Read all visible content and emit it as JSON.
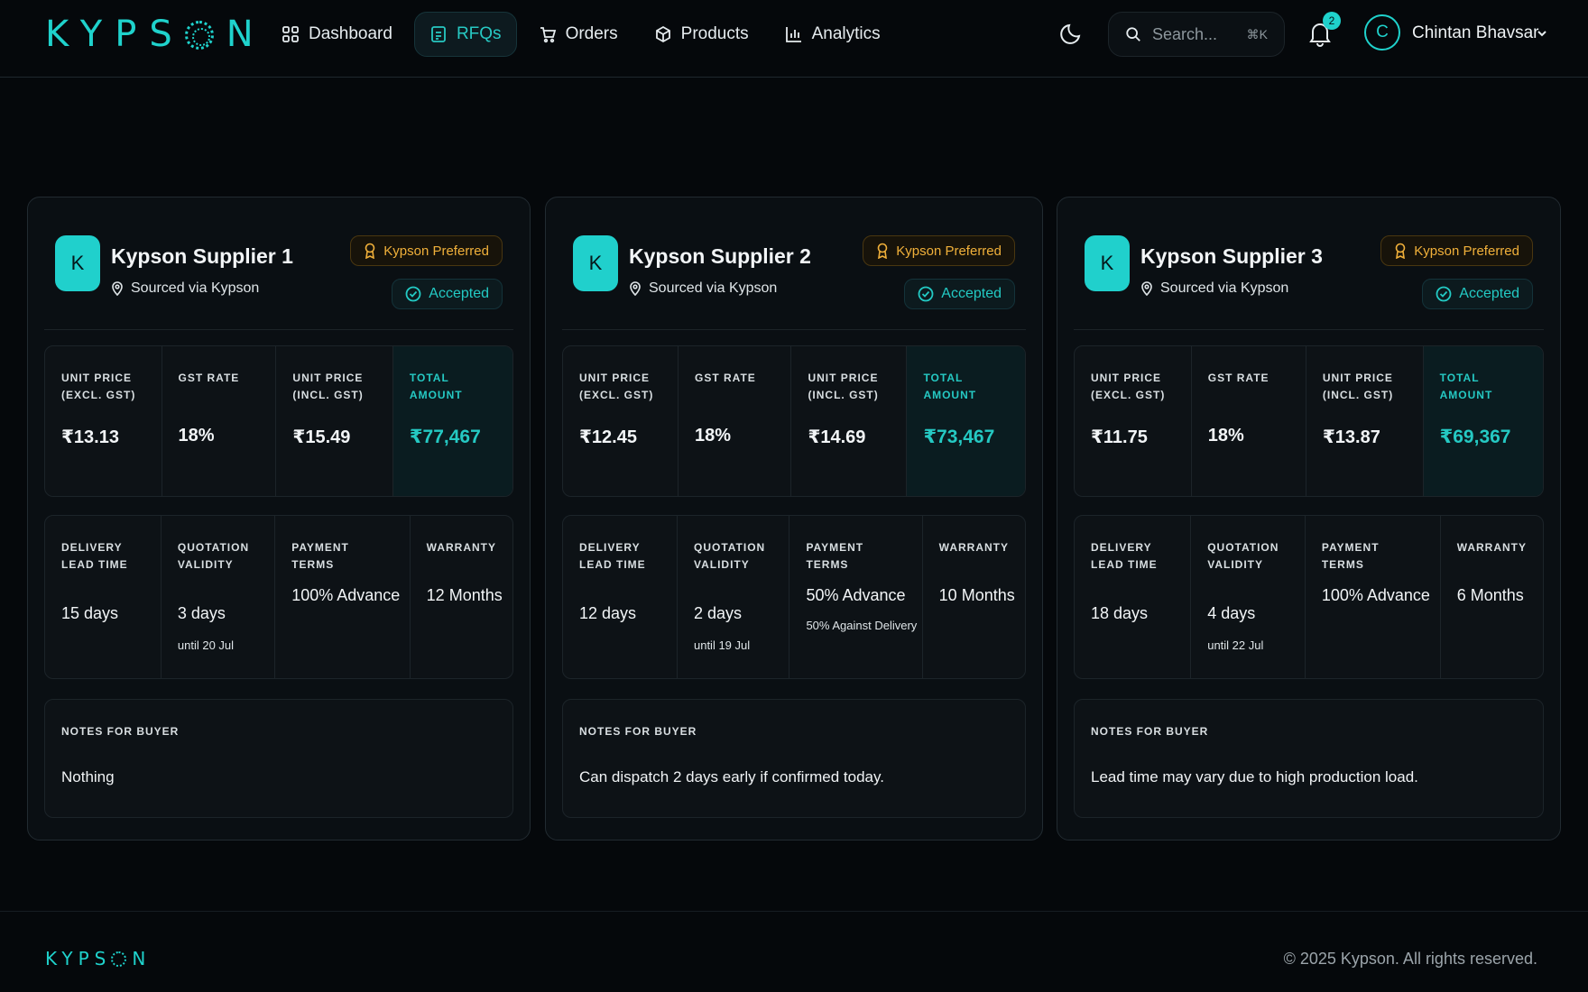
{
  "brand": {
    "logo_left": "KYPS",
    "logo_right": "N",
    "accent_color": "#1fd2cc"
  },
  "nav": {
    "items": [
      {
        "label": "Dashboard",
        "icon": "grid-icon",
        "active": false
      },
      {
        "label": "RFQs",
        "icon": "document-icon",
        "active": true
      },
      {
        "label": "Orders",
        "icon": "cart-icon",
        "active": false
      },
      {
        "label": "Products",
        "icon": "box-icon",
        "active": false
      },
      {
        "label": "Analytics",
        "icon": "bar-chart-icon",
        "active": false
      }
    ]
  },
  "header": {
    "search_placeholder": "Search...",
    "search_shortcut": "⌘K",
    "notification_count": "2",
    "user_initial": "C",
    "user_name": "Chintan Bhavsar"
  },
  "labels": {
    "unit_price_excl": "UNIT PRICE (EXCL. GST)",
    "gst_rate": "GST RATE",
    "unit_price_incl": "UNIT PRICE (INCL. GST)",
    "total_amount": "TOTAL AMOUNT",
    "delivery_lead_time": "DELIVERY LEAD TIME",
    "quotation_validity": "QUOTATION VALIDITY",
    "payment_terms": "PAYMENT TERMS",
    "warranty": "WARRANTY",
    "notes_for_buyer": "NOTES FOR BUYER"
  },
  "suppliers": [
    {
      "initial": "K",
      "name": "Kypson Supplier 1",
      "source": "Sourced via Kypson",
      "preferred_label": "Kypson Preferred",
      "status": "Accepted",
      "unit_price_excl": "₹13.13",
      "gst_rate": "18%",
      "unit_price_incl": "₹15.49",
      "total_amount": "₹77,467",
      "delivery_lead_time": "15 days",
      "quotation_validity": "3 days",
      "validity_until": "until 20 Jul",
      "payment_terms": "100% Advance",
      "payment_terms_sub": "",
      "warranty": "12 Months",
      "notes": "Nothing"
    },
    {
      "initial": "K",
      "name": "Kypson Supplier 2",
      "source": "Sourced via Kypson",
      "preferred_label": "Kypson Preferred",
      "status": "Accepted",
      "unit_price_excl": "₹12.45",
      "gst_rate": "18%",
      "unit_price_incl": "₹14.69",
      "total_amount": "₹73,467",
      "delivery_lead_time": "12 days",
      "quotation_validity": "2 days",
      "validity_until": "until 19 Jul",
      "payment_terms": "50% Advance",
      "payment_terms_sub": "50% Against Delivery",
      "warranty": "10 Months",
      "notes": "Can dispatch 2 days early if confirmed today."
    },
    {
      "initial": "K",
      "name": "Kypson Supplier 3",
      "source": "Sourced via Kypson",
      "preferred_label": "Kypson Preferred",
      "status": "Accepted",
      "unit_price_excl": "₹11.75",
      "gst_rate": "18%",
      "unit_price_incl": "₹13.87",
      "total_amount": "₹69,367",
      "delivery_lead_time": "18 days",
      "quotation_validity": "4 days",
      "validity_until": "until 22 Jul",
      "payment_terms": "100% Advance",
      "payment_terms_sub": "",
      "warranty": "6 Months",
      "notes": "Lead time may vary due to high production load."
    }
  ],
  "footer": {
    "logo_left": "KYPS",
    "logo_right": "N",
    "copyright": "© 2025 Kypson. All rights reserved."
  }
}
